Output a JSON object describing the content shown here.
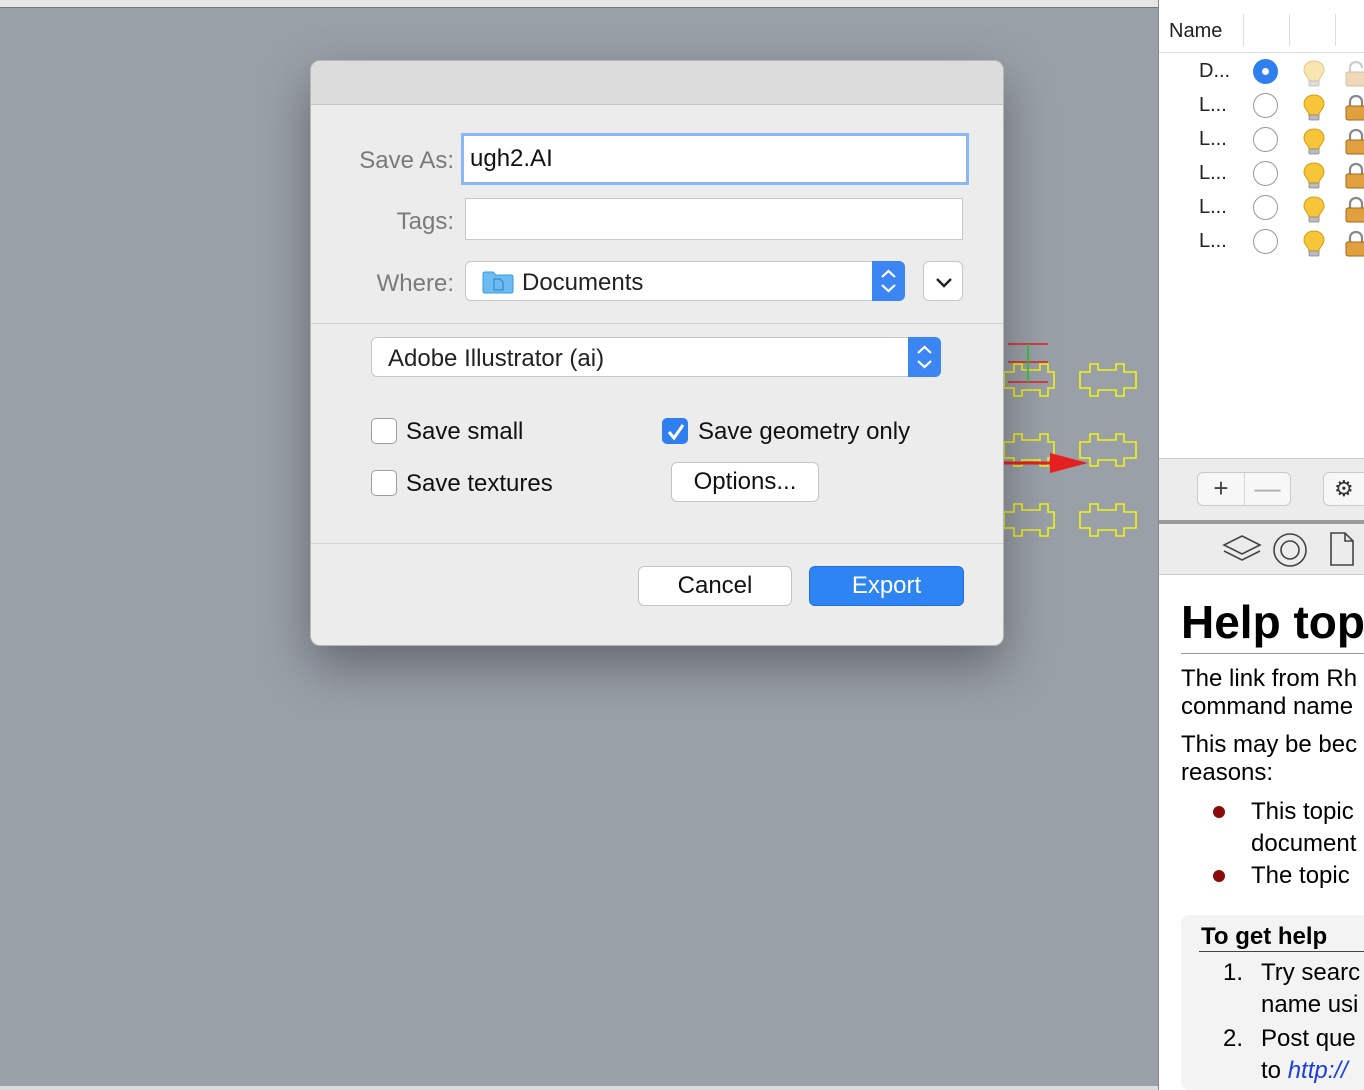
{
  "dialog": {
    "save_as_label": "Save As:",
    "save_as_value": "ugh2.AI",
    "tags_label": "Tags:",
    "tags_value": "",
    "where_label": "Where:",
    "where_value": "Documents",
    "format_value": "Adobe Illustrator (ai)",
    "save_small_label": "Save small",
    "save_small_checked": false,
    "save_textures_label": "Save textures",
    "save_textures_checked": false,
    "save_geometry_label": "Save geometry only",
    "save_geometry_checked": true,
    "options_label": "Options...",
    "cancel_label": "Cancel",
    "export_label": "Export"
  },
  "layers_panel": {
    "column_name": "Name",
    "rows": [
      {
        "name": "D...",
        "current": true,
        "visible": true,
        "locked": false
      },
      {
        "name": "L...",
        "current": false,
        "visible": true,
        "locked": true
      },
      {
        "name": "L...",
        "current": false,
        "visible": true,
        "locked": true
      },
      {
        "name": "L...",
        "current": false,
        "visible": true,
        "locked": true
      },
      {
        "name": "L...",
        "current": false,
        "visible": true,
        "locked": true
      },
      {
        "name": "L...",
        "current": false,
        "visible": true,
        "locked": true
      }
    ],
    "add_label": "+",
    "remove_label": "—",
    "gear_icon": "gear-icon"
  },
  "help": {
    "title": "Help top",
    "p1_line1": "The link from Rh",
    "p1_line2": "command name",
    "p2_line1": "This may be bec",
    "p2_line2": "reasons:",
    "bullet1_line1": "This topic",
    "bullet1_line2": "document",
    "bullet2_line1": "The topic",
    "box_heading": "To get help",
    "step1_num": "1.",
    "step1_line1": "Try searc",
    "step1_line2": "name usi",
    "step2_num": "2.",
    "step2_line1": "Post que",
    "step2_line2_prefix": "to ",
    "step2_link": "http://"
  },
  "colors": {
    "accent": "#2f7ff0",
    "viewport_bg": "#9aa0a8",
    "geometry_curve": "#f2f213",
    "arrow": "#e62020",
    "bullet": "#8b0a0a"
  }
}
